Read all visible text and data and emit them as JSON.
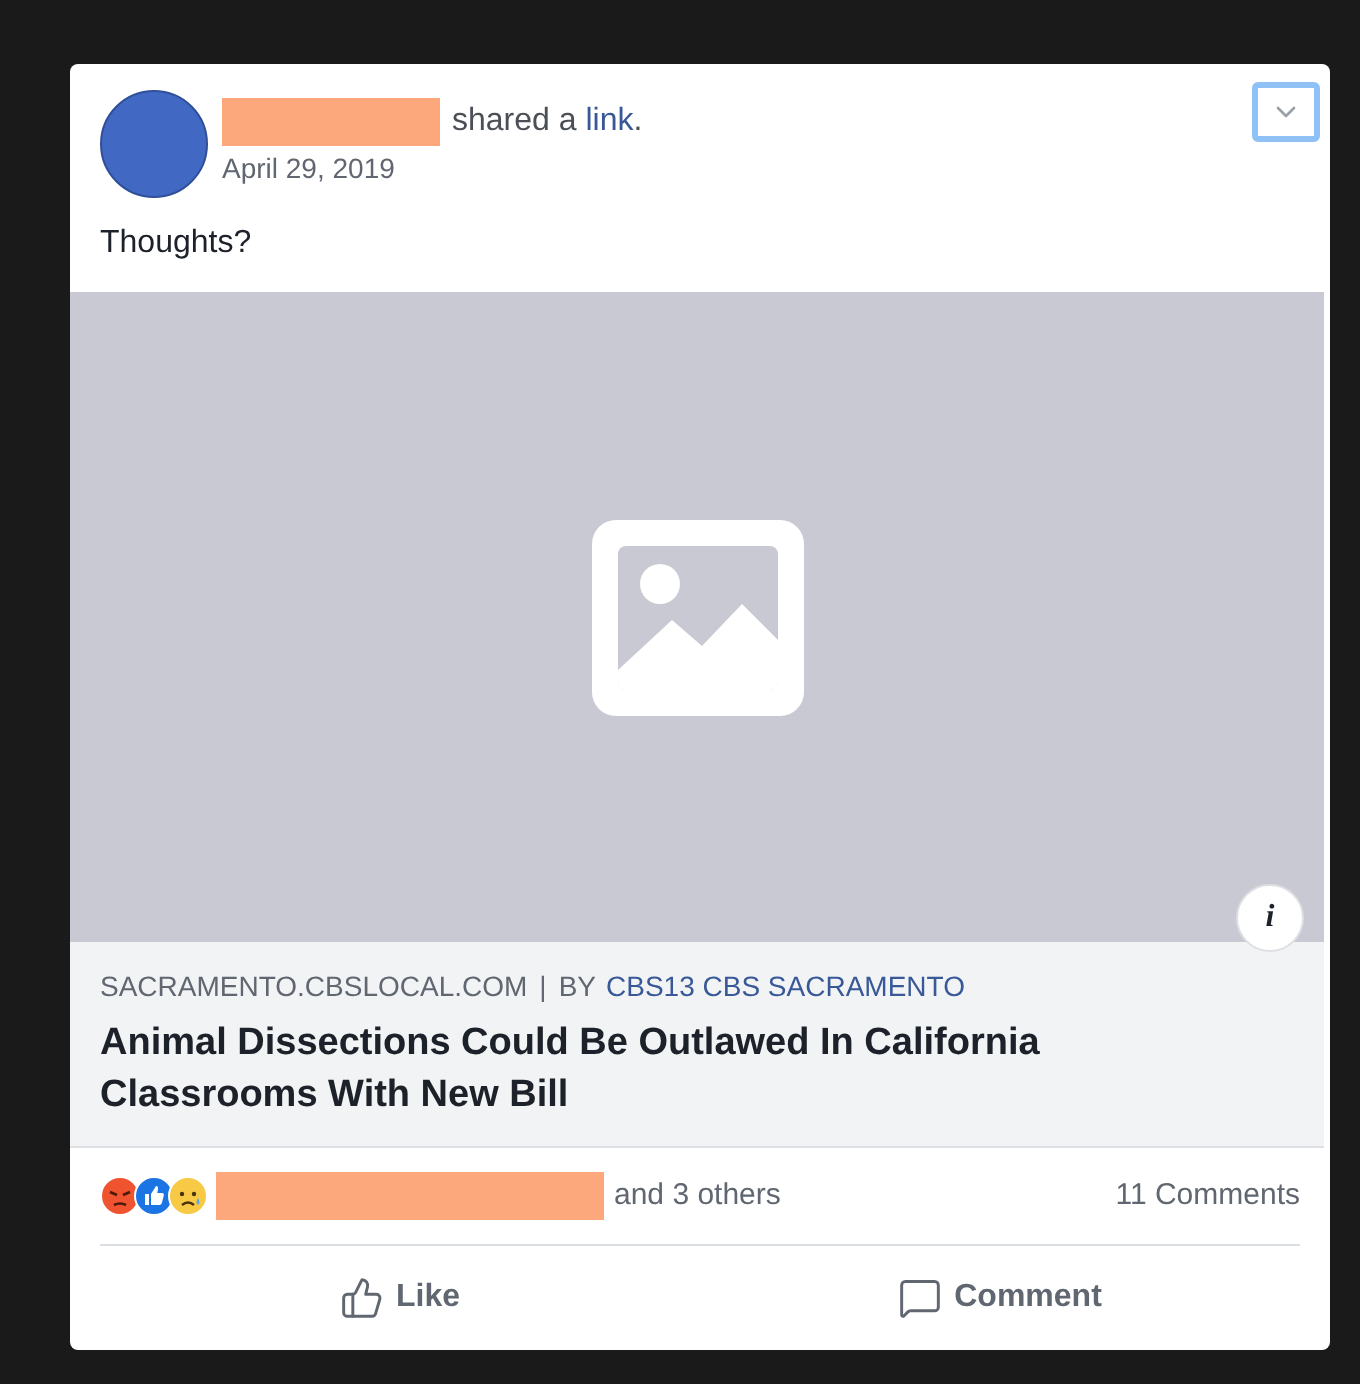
{
  "post": {
    "action_text": "shared a",
    "link_text": "link",
    "punct": ".",
    "date": "April 29, 2019",
    "message": "Thoughts?"
  },
  "link_preview": {
    "domain": "SACRAMENTO.CBSLOCAL.COM",
    "separator": "|",
    "by": "BY",
    "author": "CBS13 CBS SACRAMENTO",
    "title": "Animal Dissections Could Be Outlawed In California Classrooms With New Bill",
    "info": "i"
  },
  "reactions": {
    "emojis": [
      {
        "kind": "angry"
      },
      {
        "kind": "like"
      },
      {
        "kind": "sad"
      }
    ],
    "others": "and 3 others",
    "comments": "11 Comments"
  },
  "actions": [
    {
      "kind": "like",
      "label": "Like"
    },
    {
      "kind": "comment",
      "label": "Comment"
    }
  ]
}
